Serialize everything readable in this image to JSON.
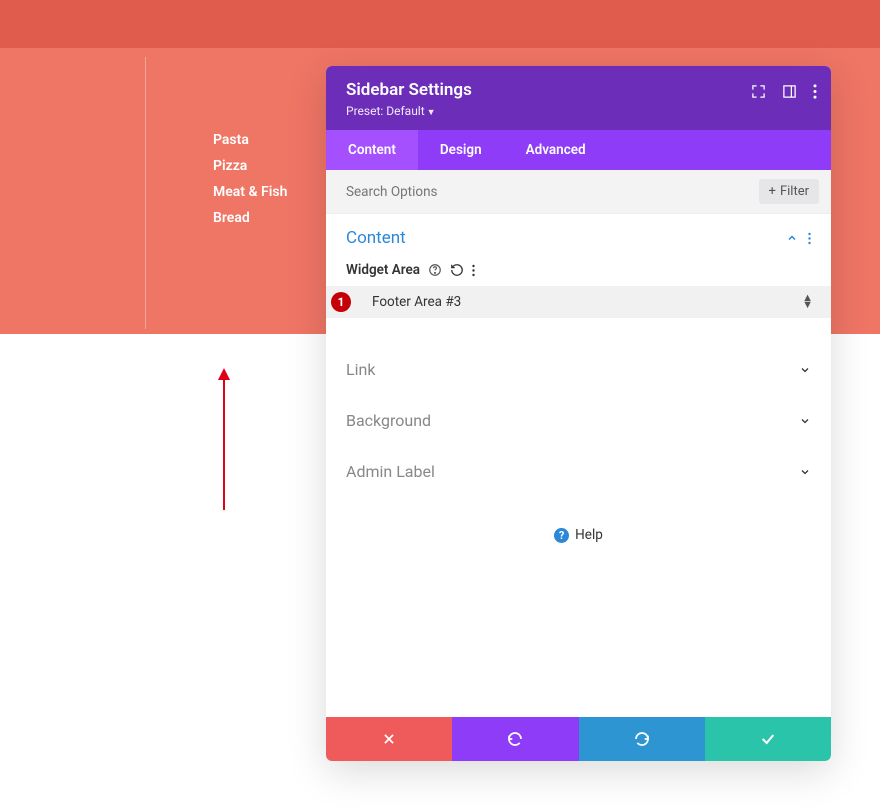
{
  "menu": {
    "items": [
      "Pasta",
      "Pizza",
      "Meat & Fish",
      "Bread"
    ]
  },
  "panel": {
    "title": "Sidebar Settings",
    "preset_label": "Preset: Default",
    "tabs": {
      "content": "Content",
      "design": "Design",
      "advanced": "Advanced"
    },
    "search_placeholder": "Search Options",
    "filter_label": "Filter"
  },
  "content_section": {
    "title": "Content",
    "field_label": "Widget Area",
    "select_value": "Footer Area #3",
    "annotation": "1"
  },
  "collapsed_sections": {
    "link": "Link",
    "background": "Background",
    "admin_label": "Admin Label"
  },
  "help_label": "Help"
}
